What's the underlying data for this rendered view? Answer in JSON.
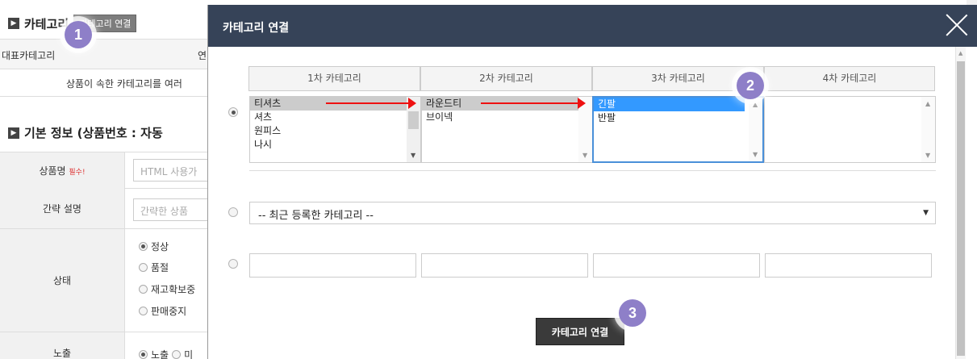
{
  "background": {
    "category_section": {
      "title": "카테고리",
      "button_label": "카테고리 연결",
      "rep_category_label": "대표카테고리",
      "right_header_partial": "연",
      "info_text": "상품이 속한 카테고리를 여러"
    },
    "basic_info": {
      "title": "기본 정보 (상품번호 : 자동",
      "rows": [
        {
          "label": "상품명",
          "required": "필수!",
          "input_placeholder": "HTML 사용가"
        },
        {
          "label": "간략 설명",
          "input_placeholder": "간략한 상품"
        },
        {
          "label": "상태",
          "options": [
            "정상",
            "품절",
            "재고확보중",
            "판매중지"
          ],
          "selected": 0
        },
        {
          "label": "노출",
          "options": [
            "노출",
            "미"
          ]
        }
      ]
    }
  },
  "modal": {
    "title": "카테고리 연결",
    "close_label": "close",
    "column_headers": [
      "1차 카테고리",
      "2차 카테고리",
      "3차 카테고리",
      "4차 카테고리"
    ],
    "lists": {
      "level1": [
        "티셔츠",
        "셔츠",
        "원피스",
        "나시"
      ],
      "level2": [
        "라운드티",
        "브이넥"
      ],
      "level3": [
        "긴팔",
        "반팔"
      ],
      "level4": []
    },
    "selected": {
      "level1": "티셔츠",
      "level2": "라운드티",
      "level3": "긴팔"
    },
    "recent_select": "-- 최근 등록한 카테고리 --",
    "connect_button": "카테고리 연결"
  },
  "step_badges": [
    "1",
    "2",
    "3"
  ],
  "colors": {
    "modal_header": "#364358",
    "badge": "#8e7fc8",
    "arrow": "#ee1111",
    "selected_blue": "#3399ff",
    "selected_gray": "#cccccc"
  }
}
